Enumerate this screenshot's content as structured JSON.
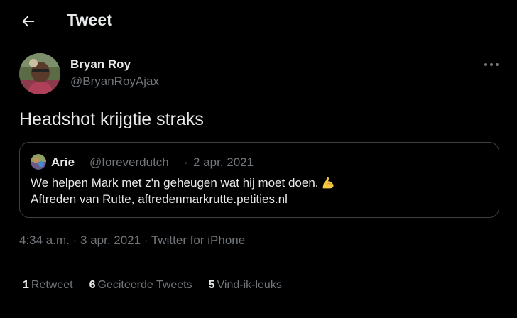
{
  "header": {
    "title": "Tweet",
    "back_icon": "arrow-left-icon"
  },
  "tweet": {
    "display_name": "Bryan Roy",
    "handle": "@BryanRoyAjax",
    "text": "Headshot krijgtie straks",
    "more_icon": "more-horizontal-icon",
    "timestamp": "4:34 a.m.",
    "separator": "·",
    "date": "3 apr. 2021",
    "source": "Twitter for iPhone"
  },
  "quote": {
    "display_name": "Arie",
    "handle": "@foreverdutch",
    "separator": "·",
    "date": "2 apr. 2021",
    "line1": "We helpen Mark met z'n geheugen wat hij moet doen.",
    "line1_emoji": "flexed-biceps-emoji",
    "line2": "Aftreden van Rutte, aftredenmarkrutte.petities.nl"
  },
  "stats": {
    "retweets_count": "1",
    "retweets_label": "Retweet",
    "quotes_count": "6",
    "quotes_label": "Geciteerde Tweets",
    "likes_count": "5",
    "likes_label": "Vind-ik-leuks"
  },
  "colors": {
    "background": "#000000",
    "text_primary": "#e7e9ea",
    "text_secondary": "#71767b",
    "border": "#2f3336"
  }
}
